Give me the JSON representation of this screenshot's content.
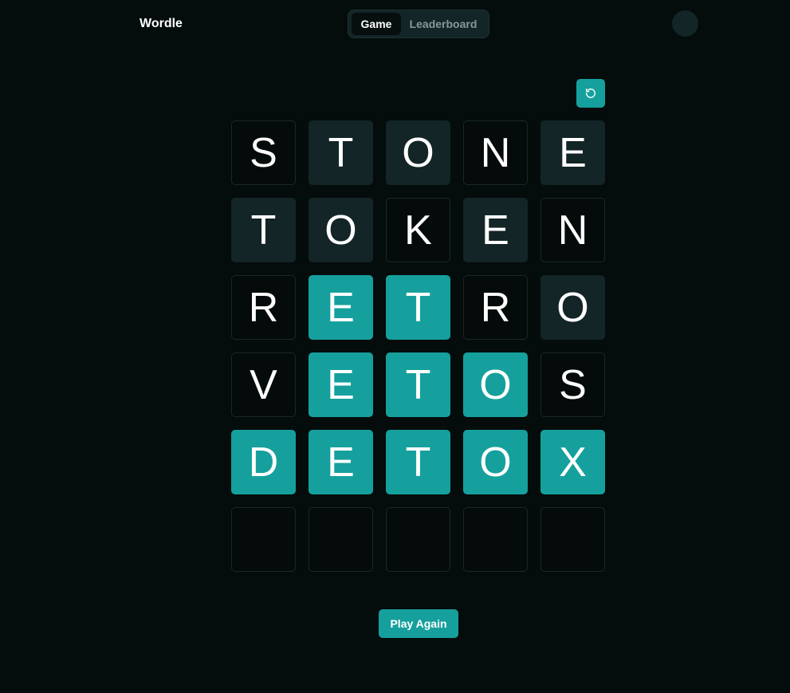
{
  "header": {
    "app_title": "Wordle",
    "tabs": [
      {
        "label": "Game",
        "active": true
      },
      {
        "label": "Leaderboard",
        "active": false
      }
    ],
    "avatar_icon": "user-avatar"
  },
  "controls": {
    "reset_icon": "refresh-icon"
  },
  "board": {
    "rows": [
      [
        {
          "letter": "S",
          "state": "absent"
        },
        {
          "letter": "T",
          "state": "present"
        },
        {
          "letter": "O",
          "state": "present"
        },
        {
          "letter": "N",
          "state": "absent"
        },
        {
          "letter": "E",
          "state": "present"
        }
      ],
      [
        {
          "letter": "T",
          "state": "present"
        },
        {
          "letter": "O",
          "state": "present"
        },
        {
          "letter": "K",
          "state": "absent"
        },
        {
          "letter": "E",
          "state": "present"
        },
        {
          "letter": "N",
          "state": "absent"
        }
      ],
      [
        {
          "letter": "R",
          "state": "absent"
        },
        {
          "letter": "E",
          "state": "correct"
        },
        {
          "letter": "T",
          "state": "correct"
        },
        {
          "letter": "R",
          "state": "absent"
        },
        {
          "letter": "O",
          "state": "present"
        }
      ],
      [
        {
          "letter": "V",
          "state": "absent"
        },
        {
          "letter": "E",
          "state": "correct"
        },
        {
          "letter": "T",
          "state": "correct"
        },
        {
          "letter": "O",
          "state": "correct"
        },
        {
          "letter": "S",
          "state": "absent"
        }
      ],
      [
        {
          "letter": "D",
          "state": "correct"
        },
        {
          "letter": "E",
          "state": "correct"
        },
        {
          "letter": "T",
          "state": "correct"
        },
        {
          "letter": "O",
          "state": "correct"
        },
        {
          "letter": "X",
          "state": "correct"
        }
      ],
      [
        {
          "letter": "",
          "state": "empty"
        },
        {
          "letter": "",
          "state": "empty"
        },
        {
          "letter": "",
          "state": "empty"
        },
        {
          "letter": "",
          "state": "empty"
        },
        {
          "letter": "",
          "state": "empty"
        }
      ]
    ]
  },
  "footer": {
    "play_again_label": "Play Again"
  },
  "colors": {
    "background": "#040c0c",
    "accent": "#16a09d",
    "present": "#132526",
    "tile_border": "#1a2828",
    "muted_text": "#8a9797"
  }
}
